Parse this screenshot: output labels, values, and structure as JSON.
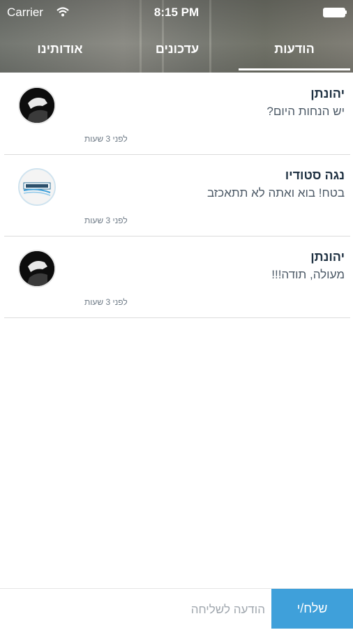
{
  "status_bar": {
    "carrier": "Carrier",
    "time": "8:15 PM"
  },
  "tabs": [
    {
      "label": "הודעות",
      "active": true
    },
    {
      "label": "עדכונים",
      "active": false
    },
    {
      "label": "אודותינו",
      "active": false
    }
  ],
  "messages": [
    {
      "sender": "יהונתן",
      "text": "יש הנחות היום?",
      "time": "לפני 3 שעות",
      "avatar": "dark-photo-avatar"
    },
    {
      "sender": "נגה סטודיו",
      "text": "בטח! בוא ואתה לא תתאכזב",
      "time": "לפני 3 שעות",
      "avatar": "studio-logo-avatar"
    },
    {
      "sender": "יהונתן",
      "text": "מעולה, תודה!!!",
      "time": "לפני 3 שעות",
      "avatar": "dark-photo-avatar"
    }
  ],
  "composer": {
    "placeholder": "הודעה לשליחה",
    "send_label": "שלח/י"
  },
  "colors": {
    "accent": "#3fa0da",
    "name_text": "#1f3142",
    "divider": "#dcdcdc"
  }
}
